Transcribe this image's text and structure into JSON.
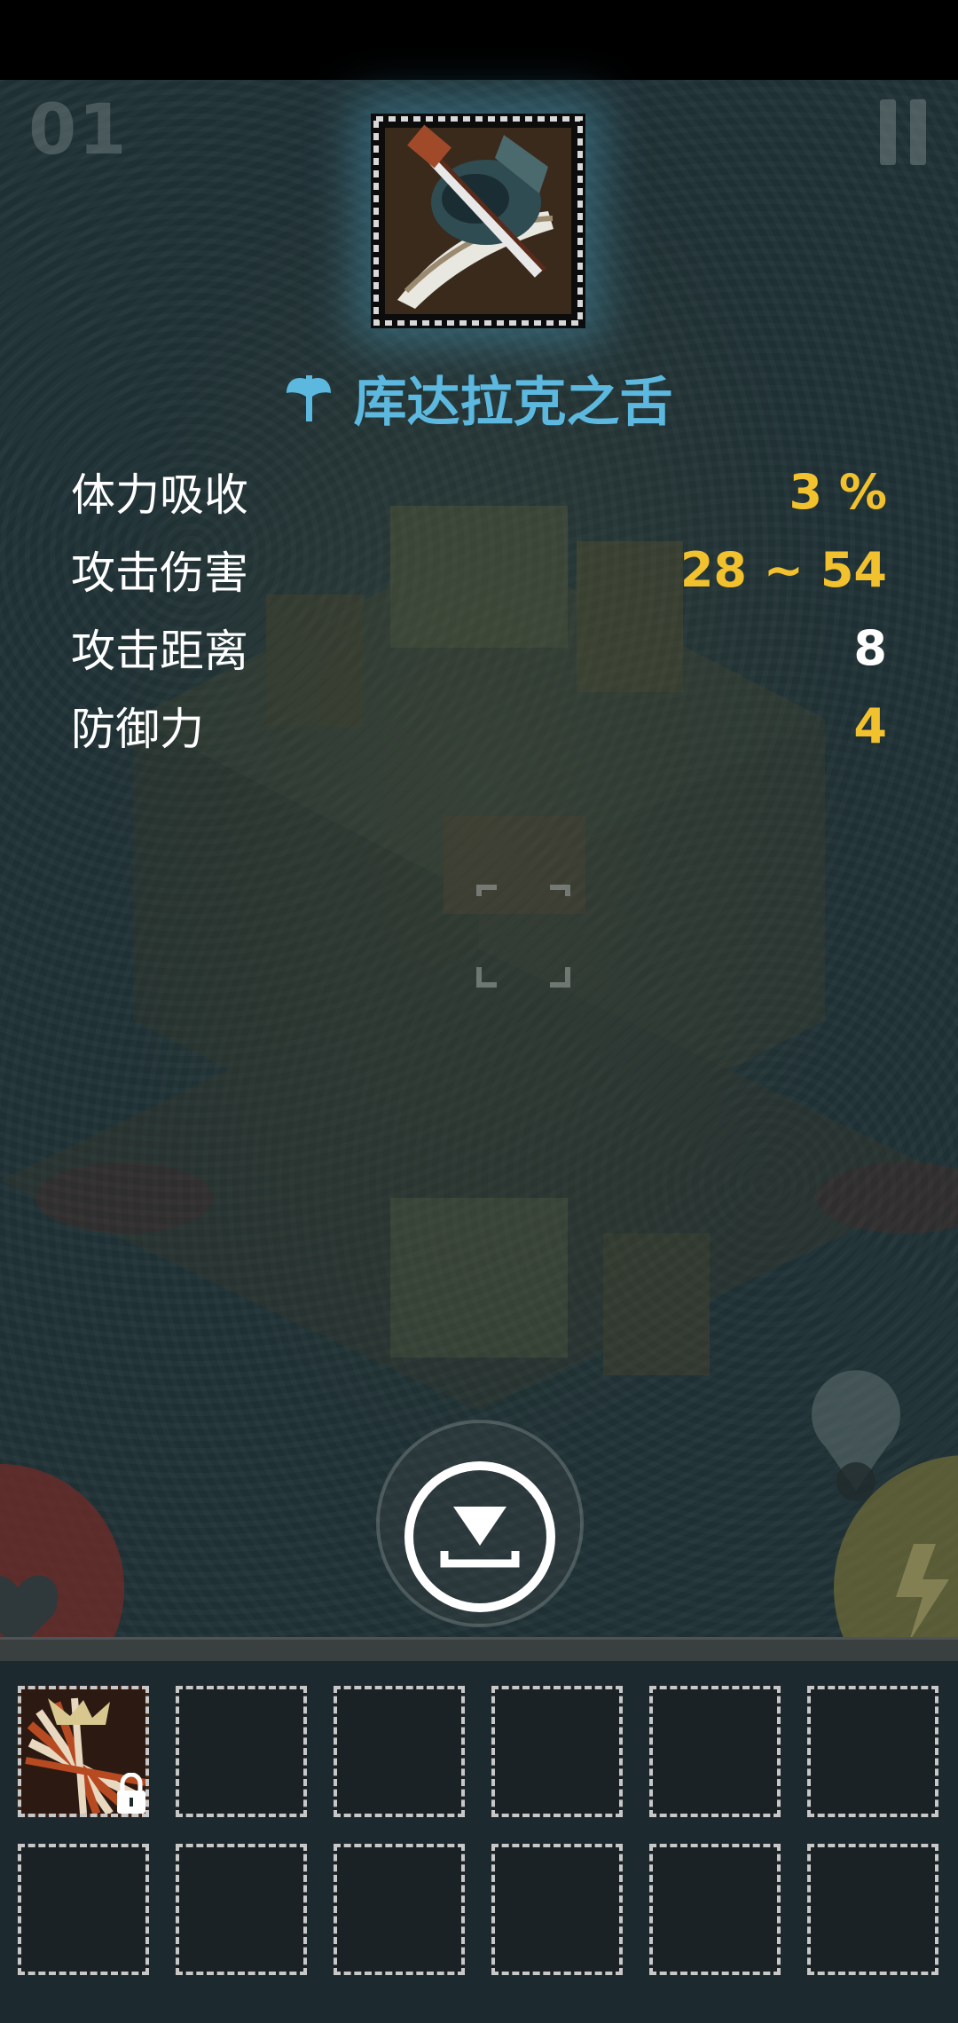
{
  "hud": {
    "level_number": "01",
    "pause_icon": "pause-icon"
  },
  "item": {
    "name": "库达拉克之舌",
    "type_icon": "axe-icon",
    "name_color": "#5cb8de",
    "stats": [
      {
        "label": "体力吸收",
        "value": "3 %",
        "color": "#f2c12e"
      },
      {
        "label": "攻击伤害",
        "value": "28 ~ 54",
        "color": "#f2c12e"
      },
      {
        "label": "攻击距离",
        "value": "8",
        "color": "#ffffff"
      },
      {
        "label": "防御力",
        "value": "4",
        "color": "#f2c12e"
      }
    ]
  },
  "actions": {
    "drop_icon": "drop-to-ground-icon"
  },
  "inventory": {
    "rows": 2,
    "cols": 6,
    "filled_slots": [
      {
        "index": 0,
        "icon": "claw-weapon-icon",
        "locked": true
      }
    ]
  }
}
